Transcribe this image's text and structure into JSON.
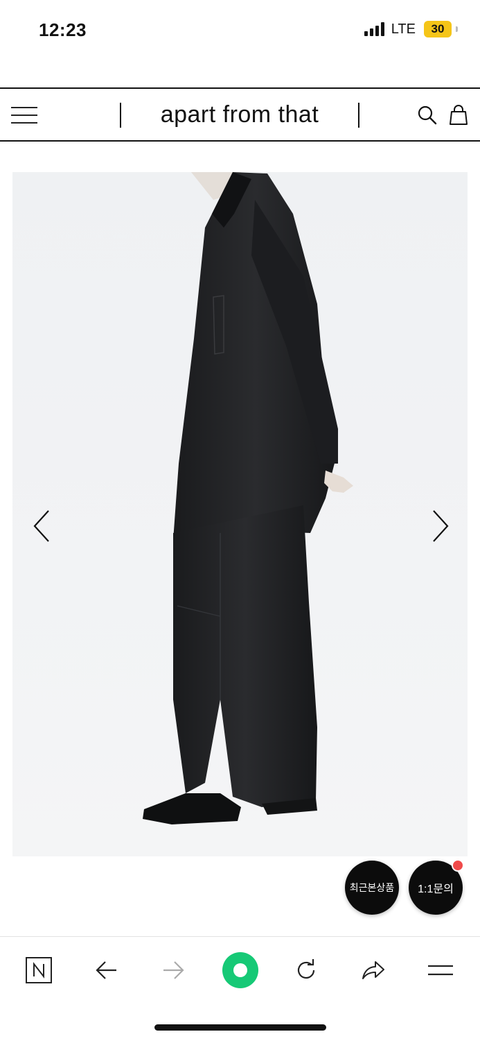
{
  "status_bar": {
    "time": "12:23",
    "network": "LTE",
    "battery": "30"
  },
  "header": {
    "brand": "apart from that",
    "icons": [
      "menu-icon",
      "search-icon",
      "shopping-bag-icon"
    ]
  },
  "product_gallery": {
    "prev_icon": "chevron-left-icon",
    "next_icon": "chevron-right-icon"
  },
  "floating_buttons": {
    "recent_label": "최근본상품",
    "inquiry_label": "1:1문의"
  },
  "browser_toolbar": {
    "icons": [
      "naver-icon",
      "back-arrow-icon",
      "forward-arrow-icon",
      "green-dot-icon",
      "refresh-icon",
      "share-icon",
      "menu-icon"
    ]
  },
  "colors": {
    "accent_green": "#16c976",
    "badge_red": "#f04b4b",
    "battery_yellow": "#f5c518"
  }
}
